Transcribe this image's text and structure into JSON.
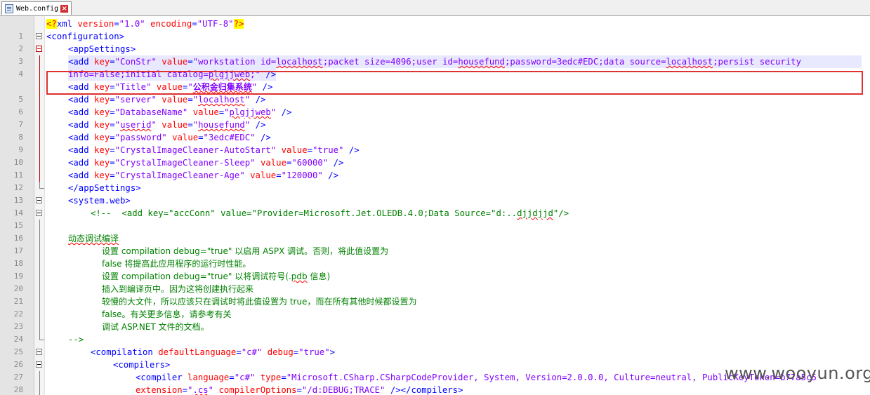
{
  "tab": {
    "title": "Web.config",
    "close": "×"
  },
  "lines": {
    "n": [
      "1",
      "2",
      "3",
      "4",
      "",
      "5",
      "6",
      "7",
      "8",
      "9",
      "10",
      "11",
      "12",
      "13",
      "14",
      "15",
      "16",
      "17",
      "18",
      "19",
      "20",
      "21",
      "22",
      "23",
      "24",
      "25",
      "26",
      "27",
      "28",
      ""
    ],
    "l1": {
      "pi_open": "<?",
      "name": "xml",
      "attr1": " version",
      "eq1": "=",
      "val1": "\"1.0\"",
      "attr2": " encoding",
      "eq2": "=",
      "val2": "\"UTF-8\"",
      "pi_close": "?>"
    },
    "l2": "<configuration>",
    "l3": "<appSettings>",
    "l4": {
      "open": "<add ",
      "k": "key",
      "eq": "=",
      "kv": "\"ConStr\"",
      "v": " value",
      "eq2": "=",
      "vv1": "\"workstation id=",
      "u1": "localhost",
      "vv2": ";packet size=4096;user id=",
      "u2": "housefund",
      "vv3": ";password=3edc#EDC;data source=",
      "u3": "localhost",
      "vv4": ";persist security"
    },
    "l4b": {
      "vv": "info=False;initial catalog=",
      "u": "plgjjweb",
      "vv2": ";\"",
      "close": " />"
    },
    "l5": {
      "open": "<add ",
      "k": "key",
      "kv": "\"Title\"",
      "v": " value",
      "q1": "\"",
      "zh": "公积金归集系统",
      "q2": "\"",
      "close": " />"
    },
    "l6": {
      "open": "<add ",
      "k": "key",
      "kv": "\"server\"",
      "v": " value",
      "q1": "\"",
      "u": "localhost",
      "q2": "\"",
      "close": " />"
    },
    "l7": {
      "open": "<add ",
      "k": "key",
      "kv": "\"DatabaseName\"",
      "v": " value",
      "q1": "\"",
      "u": "plgjjweb",
      "q2": "\"",
      "close": " />"
    },
    "l8": {
      "open": "<add ",
      "k": "key",
      "q0": "\"",
      "ku": "userid",
      "q0b": "\"",
      "v": " value",
      "q1": "\"",
      "u": "housefund",
      "q2": "\"",
      "close": " />"
    },
    "l9": {
      "open": "<add ",
      "k": "key",
      "kv": "\"password\"",
      "v": " value",
      "vv": "\"3edc#EDC\"",
      "close": " />"
    },
    "l10": {
      "open": "<add ",
      "k": "key",
      "kv": "\"CrystalImageCleaner-AutoStart\"",
      "v": " value",
      "vv": "\"true\"",
      "close": " />"
    },
    "l11": {
      "open": "<add ",
      "k": "key",
      "kv": "\"CrystalImageCleaner-Sleep\"",
      "v": " value",
      "vv": "\"60000\"",
      "close": " />"
    },
    "l12": {
      "open": "<add ",
      "k": "key",
      "kv": "\"CrystalImageCleaner-Age\"",
      "v": " value",
      "vv": "\"120000\"",
      "close": " />"
    },
    "l13": "</appSettings>",
    "l14": "<system.web>",
    "l15": {
      "c1": "<!--  <add key=\"accConn\" value=\"Provider=Microsoft.Jet.OLEDB.4.0;Data Source=\"d:..",
      "u": "djjdjjd",
      "c2": "\"/>"
    },
    "l17": "动态调试编译",
    "l18": "设置 compilation debug=\"true\" 以启用 ASPX 调试。否则，将此值设置为",
    "l19": "false 将提高此应用程序的运行时性能。",
    "l20": {
      "a": "设置 compilation debug=\"true\" 以将调试符号(.",
      "u": "pdb",
      "b": " 信息)"
    },
    "l21": "插入到编译页中。因为这将创建执行起来",
    "l22": "较慢的大文件，所以应该只在调试时将此值设置为 true，而在所有其他时候都设置为",
    "l23": "false。有关更多信息，请参考有关",
    "l24": "调试 ASP.NET 文件的文档。",
    "l25": "-->",
    "l26": {
      "open": "<compilation ",
      "a1": "defaultLanguage",
      "eq": "=",
      "v1": "\"c#\"",
      "a2": " debug",
      "eq2": "=",
      "v2": "\"true\"",
      "close": ">"
    },
    "l27": "<compilers>",
    "l28": {
      "open": "<compiler ",
      "a1": "language",
      "eq": "=",
      "v1": "\"c#\"",
      "a2": " type",
      "eq2": "=",
      "v2": "\"Microsoft.CSharp.CSharpCodeProvider, System, Version=2.0.0.0, Culture=neutral, PublicKeyToken=b77a5c5"
    },
    "l28b": {
      "a1": "extension",
      "eq": "=",
      "q1": "\"",
      "u": ".cs",
      "q2": "\"",
      "a2": " compilerOptions",
      "eq2": "=",
      "v2": "\"/d:DEBUG;TRACE\"",
      "close": " /></compilers>"
    }
  },
  "watermark": "www.wooyun.org",
  "colors": {
    "tag": "#0000ff",
    "attr": "#ff0000",
    "value": "#8000ff",
    "comment": "#008000",
    "highlight_box": "#e03030"
  }
}
